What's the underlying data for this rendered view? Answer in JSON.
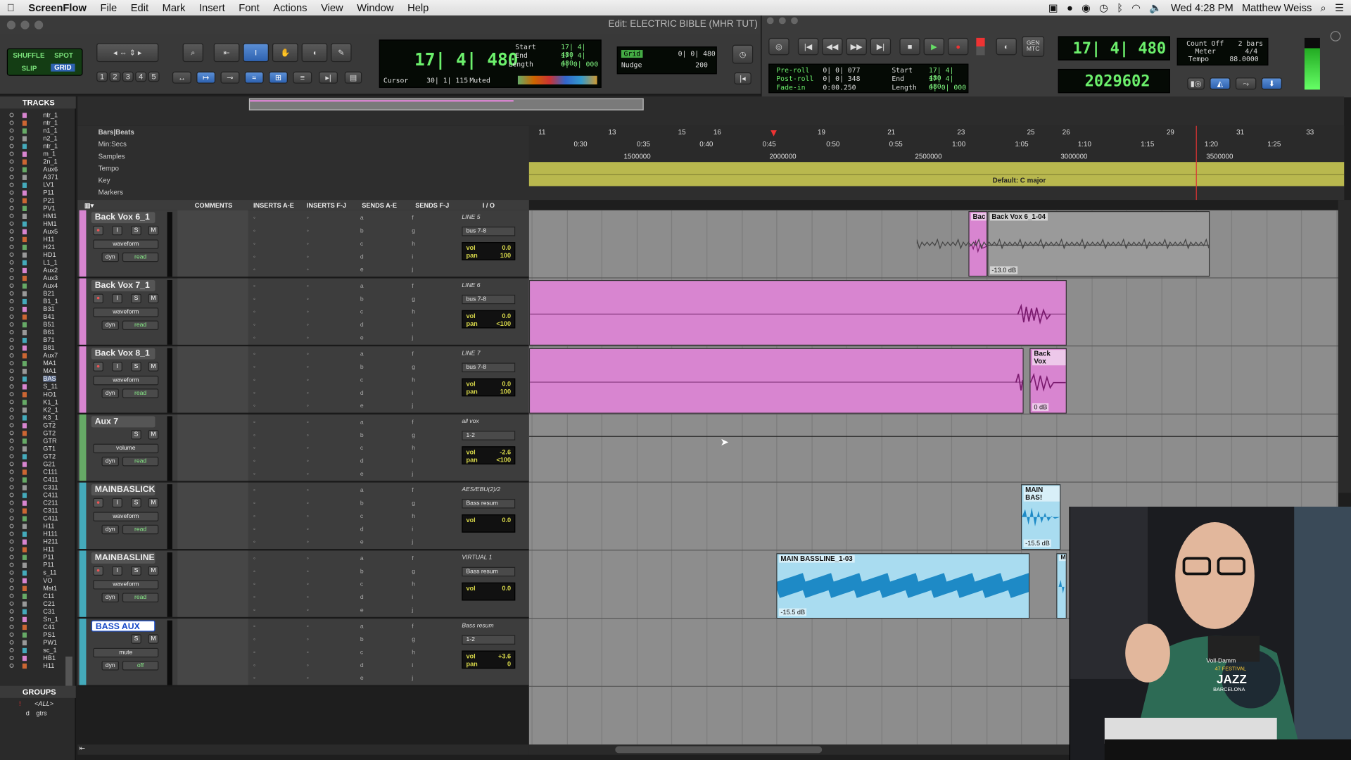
{
  "menubar": {
    "app_name": "ScreenFlow",
    "menus": [
      "File",
      "Edit",
      "Mark",
      "Insert",
      "Font",
      "Actions",
      "View",
      "Window",
      "Help"
    ],
    "clock": "Wed 4:28 PM",
    "user": "Matthew Weiss"
  },
  "window": {
    "title": "Edit: ELECTRIC BIBLE (MHR TUT)"
  },
  "toolbar": {
    "modes": {
      "shuffle": "SHUFFLE",
      "spot": "SPOT",
      "slip": "SLIP",
      "grid": "GRID"
    },
    "zoom_presets": [
      "1",
      "2",
      "3",
      "4",
      "5"
    ],
    "main_counter": "17| 4| 480",
    "start_label": "Start",
    "start_value": "17| 4| 480",
    "end_label": "End",
    "end_value": "17| 4| 480",
    "length_label": "Length",
    "length_value": "0| 0| 000",
    "cursor_label": "Cursor",
    "cursor_value": "30| 1| 115",
    "muted_label": "Muted",
    "grid_label": "Grid",
    "grid_value": "0| 0| 480",
    "nudge_label": "Nudge",
    "nudge_value": "200"
  },
  "transport": {
    "preroll_label": "Pre-roll",
    "preroll_value": "0| 0| 077",
    "postroll_label": "Post-roll",
    "postroll_value": "0| 0| 348",
    "fadein_label": "Fade-in",
    "fadein_value": "0:00.250",
    "start_label": "Start",
    "start_value": "17| 4| 480",
    "end_label": "End",
    "end_value": "17| 4| 480",
    "length_label": "Length",
    "length_value": "0| 0| 000",
    "gen_label": "GEN\nMTC",
    "counter_main": "17| 4| 480",
    "counter_sub": "2029602",
    "count_off": "Count Off",
    "meter_label": "Meter",
    "tempo_label": "Tempo",
    "bars_value": "2 bars",
    "meter_value": "4/4",
    "tempo_value": "88.0000"
  },
  "tracks_panel": {
    "title": "TRACKS",
    "items": [
      "ntr_1",
      "ntr_1",
      "n1_1",
      "n2_1",
      "ntr_1",
      "m_1",
      "2n_1",
      "Aux6",
      "A371",
      "LV1",
      "P11",
      "P21",
      "PV1",
      "HM1",
      "HM1",
      "Aux5",
      "H11",
      "H21",
      "HD1",
      "L1_1",
      "Aux2",
      "Aux3",
      "Aux4",
      "B21",
      "B1_1",
      "B31",
      "B41",
      "B51",
      "B61",
      "B71",
      "B81",
      "Aux7",
      "MA1",
      "MA1",
      "BAS",
      "S_11",
      "HO1",
      "K1_1",
      "K2_1",
      "K3_1",
      "GT2",
      "GT2",
      "GTR",
      "GT1",
      "GT2",
      "G21",
      "C111",
      "C411",
      "C311",
      "C411",
      "C211",
      "C311",
      "C411",
      "H11",
      "H111",
      "H211",
      "H11",
      "P11",
      "P11",
      "s_11",
      "VO",
      "Mst1",
      "C11",
      "C21",
      "C31",
      "Sn_1",
      "C41",
      "PS1",
      "PW1",
      "sc_1",
      "HB1",
      "H11"
    ],
    "selected_index": 34
  },
  "groups_panel": {
    "title": "GROUPS",
    "items": [
      "<ALL>",
      "gtrs"
    ],
    "group_letters": [
      "!",
      "d"
    ]
  },
  "rulers": {
    "labels": [
      "Bars|Beats",
      "Min:Secs",
      "Samples",
      "Tempo",
      "Key",
      "Markers"
    ],
    "bars": [
      "11",
      "13",
      "15",
      "16",
      "19",
      "21",
      "23",
      "25",
      "26",
      "29",
      "31",
      "33"
    ],
    "minsecs": [
      "0:30",
      "0:35",
      "0:40",
      "0:45",
      "0:50",
      "0:55",
      "1:00",
      "1:05",
      "1:10",
      "1:15",
      "1:20",
      "1:25"
    ],
    "samples": [
      "1500000",
      "2000000",
      "2500000",
      "3000000",
      "3500000"
    ],
    "key_text": "Default: C major"
  },
  "columns": {
    "comments": "COMMENTS",
    "inserts_ae": "INSERTS A-E",
    "inserts_fj": "INSERTS F-J",
    "sends_ae": "SENDS A-E",
    "sends_fj": "SENDS F-J",
    "io": "I / O"
  },
  "tracks": [
    {
      "name": "Back Vox 6_1",
      "view": "waveform",
      "auto": "read",
      "dyn": "dyn",
      "input": "LINE 5",
      "output": "bus 7-8",
      "vol": "0.0",
      "pan": "100"
    },
    {
      "name": "Back Vox 7_1",
      "view": "waveform",
      "auto": "read",
      "dyn": "dyn",
      "input": "LINE 6",
      "output": "bus 7-8",
      "vol": "0.0",
      "pan": "<100"
    },
    {
      "name": "Back Vox 8_1",
      "view": "waveform",
      "auto": "read",
      "dyn": "dyn",
      "input": "LINE 7",
      "output": "bus 7-8",
      "vol": "0.0",
      "pan": "100"
    },
    {
      "name": "Aux 7",
      "view": "volume",
      "auto": "read",
      "dyn": "dyn",
      "input": "all vox",
      "output": "1-2",
      "vol": "-2.6",
      "pan": "<100",
      "pan2": "100"
    },
    {
      "name": "MAINBASLICK1",
      "view": "waveform",
      "auto": "read",
      "dyn": "dyn",
      "input": "AES/EBU(2)/2",
      "output": "Bass resum",
      "vol": "0.0",
      "pan": ""
    },
    {
      "name": "MAINBASLINE1",
      "view": "waveform",
      "auto": "read",
      "dyn": "dyn",
      "input": "VIRTUAL 1",
      "output": "Bass resum",
      "vol": "0.0",
      "pan": ""
    },
    {
      "name": "BASS AUX",
      "view": "mute",
      "auto": "off",
      "dyn": "dyn",
      "input": "Bass resum",
      "output": "1-2",
      "vol": "+3.6",
      "pan": "0"
    }
  ],
  "send_letters": {
    "ae": [
      "a",
      "b",
      "c",
      "d",
      "e"
    ],
    "fj": [
      "f",
      "g",
      "h",
      "i",
      "j"
    ]
  },
  "track_buttons": {
    "rec": "●",
    "input": "I",
    "solo": "S",
    "mute": "M"
  },
  "clips": [
    {
      "name": "Bac",
      "lane": 0,
      "db": ""
    },
    {
      "name": "Back Vox 6_1-04",
      "lane": 0,
      "db": "-13.0 dB"
    },
    {
      "name": "Back Vox",
      "lane": 2,
      "db": "0 dB"
    },
    {
      "name": "MAIN BAS!",
      "lane": 4,
      "db": "-15.5 dB"
    },
    {
      "name": "MAIN BASSLINE_1-03",
      "lane": 5,
      "db": "-15.5 dB"
    },
    {
      "name": "M",
      "lane": 5,
      "db": ""
    }
  ],
  "webcam": {
    "shirt_text_1": "Voll-Damm",
    "shirt_text_2": "47 FESTIVAL",
    "shirt_text_3": "JAZZ",
    "shirt_text_4": "BARCELONA"
  },
  "colors": {
    "pink_clip": "#d885d0",
    "blue_clip": "#a9dcf0",
    "wave_blue": "#1e8ac6",
    "wave_pink": "#7a1a6e",
    "key_bar": "#b9b84e",
    "lcd_green": "#6cf06c"
  }
}
